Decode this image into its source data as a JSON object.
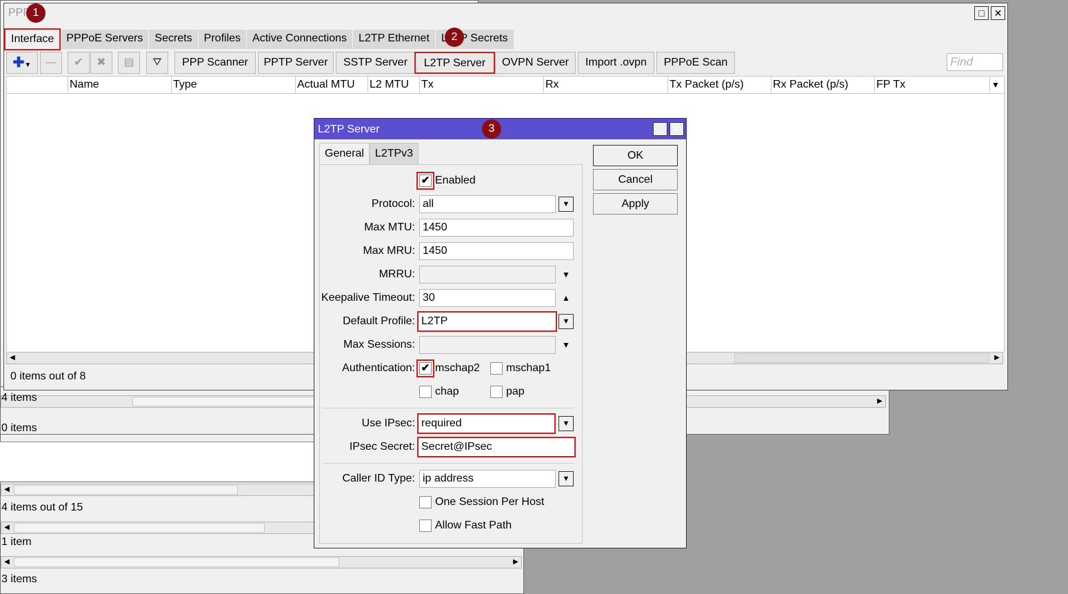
{
  "ppp_window": {
    "title": "PPP",
    "tabs": [
      "Interface",
      "PPPoE Servers",
      "Secrets",
      "Profiles",
      "Active Connections",
      "L2TP Ethernet",
      "L2TP Secrets"
    ],
    "toolbar": {
      "add_icon": "plus-icon",
      "buttons": [
        "PPP Scanner",
        "PPTP Server",
        "SSTP Server",
        "L2TP Server",
        "OVPN Server",
        "Import .ovpn",
        "PPPoE Scan"
      ],
      "find_placeholder": "Find"
    },
    "columns": [
      "Name",
      "Type",
      "Actual MTU",
      "L2 MTU",
      "Tx",
      "Rx",
      "Tx Packet (p/s)",
      "Rx Packet (p/s)",
      "FP Tx"
    ],
    "status": "0 items out of 8"
  },
  "background_windows": {
    "status_1": "4 items",
    "status_2": "0 items",
    "status_3": "4 items out of 15",
    "status_4": "1 item",
    "status_5": "3 items"
  },
  "badges": [
    "1",
    "2",
    "3"
  ],
  "dialog": {
    "title": "L2TP Server",
    "tabs": [
      "General",
      "L2TPv3"
    ],
    "enabled": {
      "label": "Enabled",
      "checked": true
    },
    "fields": {
      "protocol": {
        "label": "Protocol:",
        "value": "all"
      },
      "max_mtu": {
        "label": "Max MTU:",
        "value": "1450"
      },
      "max_mru": {
        "label": "Max MRU:",
        "value": "1450"
      },
      "mrru": {
        "label": "MRRU:",
        "value": ""
      },
      "keepalive": {
        "label": "Keepalive Timeout:",
        "value": "30"
      },
      "default_profile": {
        "label": "Default Profile:",
        "value": "L2TP"
      },
      "max_sessions": {
        "label": "Max Sessions:",
        "value": ""
      },
      "authentication": {
        "label": "Authentication:"
      },
      "use_ipsec": {
        "label": "Use IPsec:",
        "value": "required"
      },
      "ipsec_secret": {
        "label": "IPsec Secret:",
        "value": "Secret@IPsec"
      },
      "caller_id": {
        "label": "Caller ID Type:",
        "value": "ip address"
      }
    },
    "auth": {
      "mschap2": {
        "label": "mschap2",
        "checked": true
      },
      "mschap1": {
        "label": "mschap1",
        "checked": false
      },
      "chap": {
        "label": "chap",
        "checked": false
      },
      "pap": {
        "label": "pap",
        "checked": false
      }
    },
    "one_session": {
      "label": "One Session Per Host",
      "checked": false
    },
    "fast_path": {
      "label": "Allow Fast Path",
      "checked": false
    },
    "buttons": {
      "ok": "OK",
      "cancel": "Cancel",
      "apply": "Apply"
    }
  },
  "colors": {
    "highlight": "#d21e1e",
    "dialog_title": "#5a4fcf",
    "badge": "#8b0d14"
  }
}
